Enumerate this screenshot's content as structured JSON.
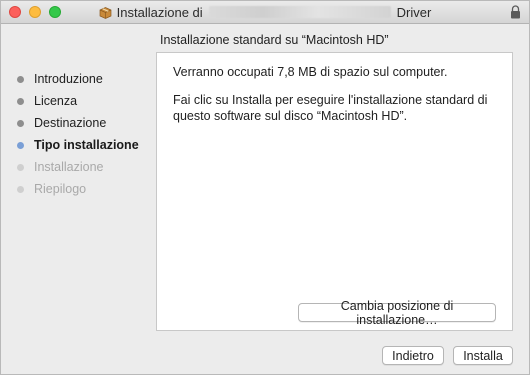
{
  "window": {
    "title_prefix": "Installazione di",
    "title_suffix": "Driver"
  },
  "section_title": "Installazione standard su “Macintosh HD”",
  "steps": [
    {
      "label": "Introduzione",
      "state": "done"
    },
    {
      "label": "Licenza",
      "state": "done"
    },
    {
      "label": "Destinazione",
      "state": "done"
    },
    {
      "label": "Tipo installazione",
      "state": "current"
    },
    {
      "label": "Installazione",
      "state": "future"
    },
    {
      "label": "Riepilogo",
      "state": "future"
    }
  ],
  "content": {
    "line1": "Verranno occupati 7,8 MB di spazio sul computer.",
    "line2": "Fai clic su Installa per eseguire l'installazione standard di questo software sul disco “Macintosh HD”."
  },
  "buttons": {
    "change_location": "Cambia posizione di installazione…",
    "back": "Indietro",
    "install": "Installa"
  },
  "icons": {
    "package": "package-icon",
    "lock": "lock-icon"
  },
  "colors": {
    "current_step_dot": "#7a9fd6",
    "done_step_dot": "#8e8e8e",
    "future_step_text": "#a9a9a9"
  }
}
